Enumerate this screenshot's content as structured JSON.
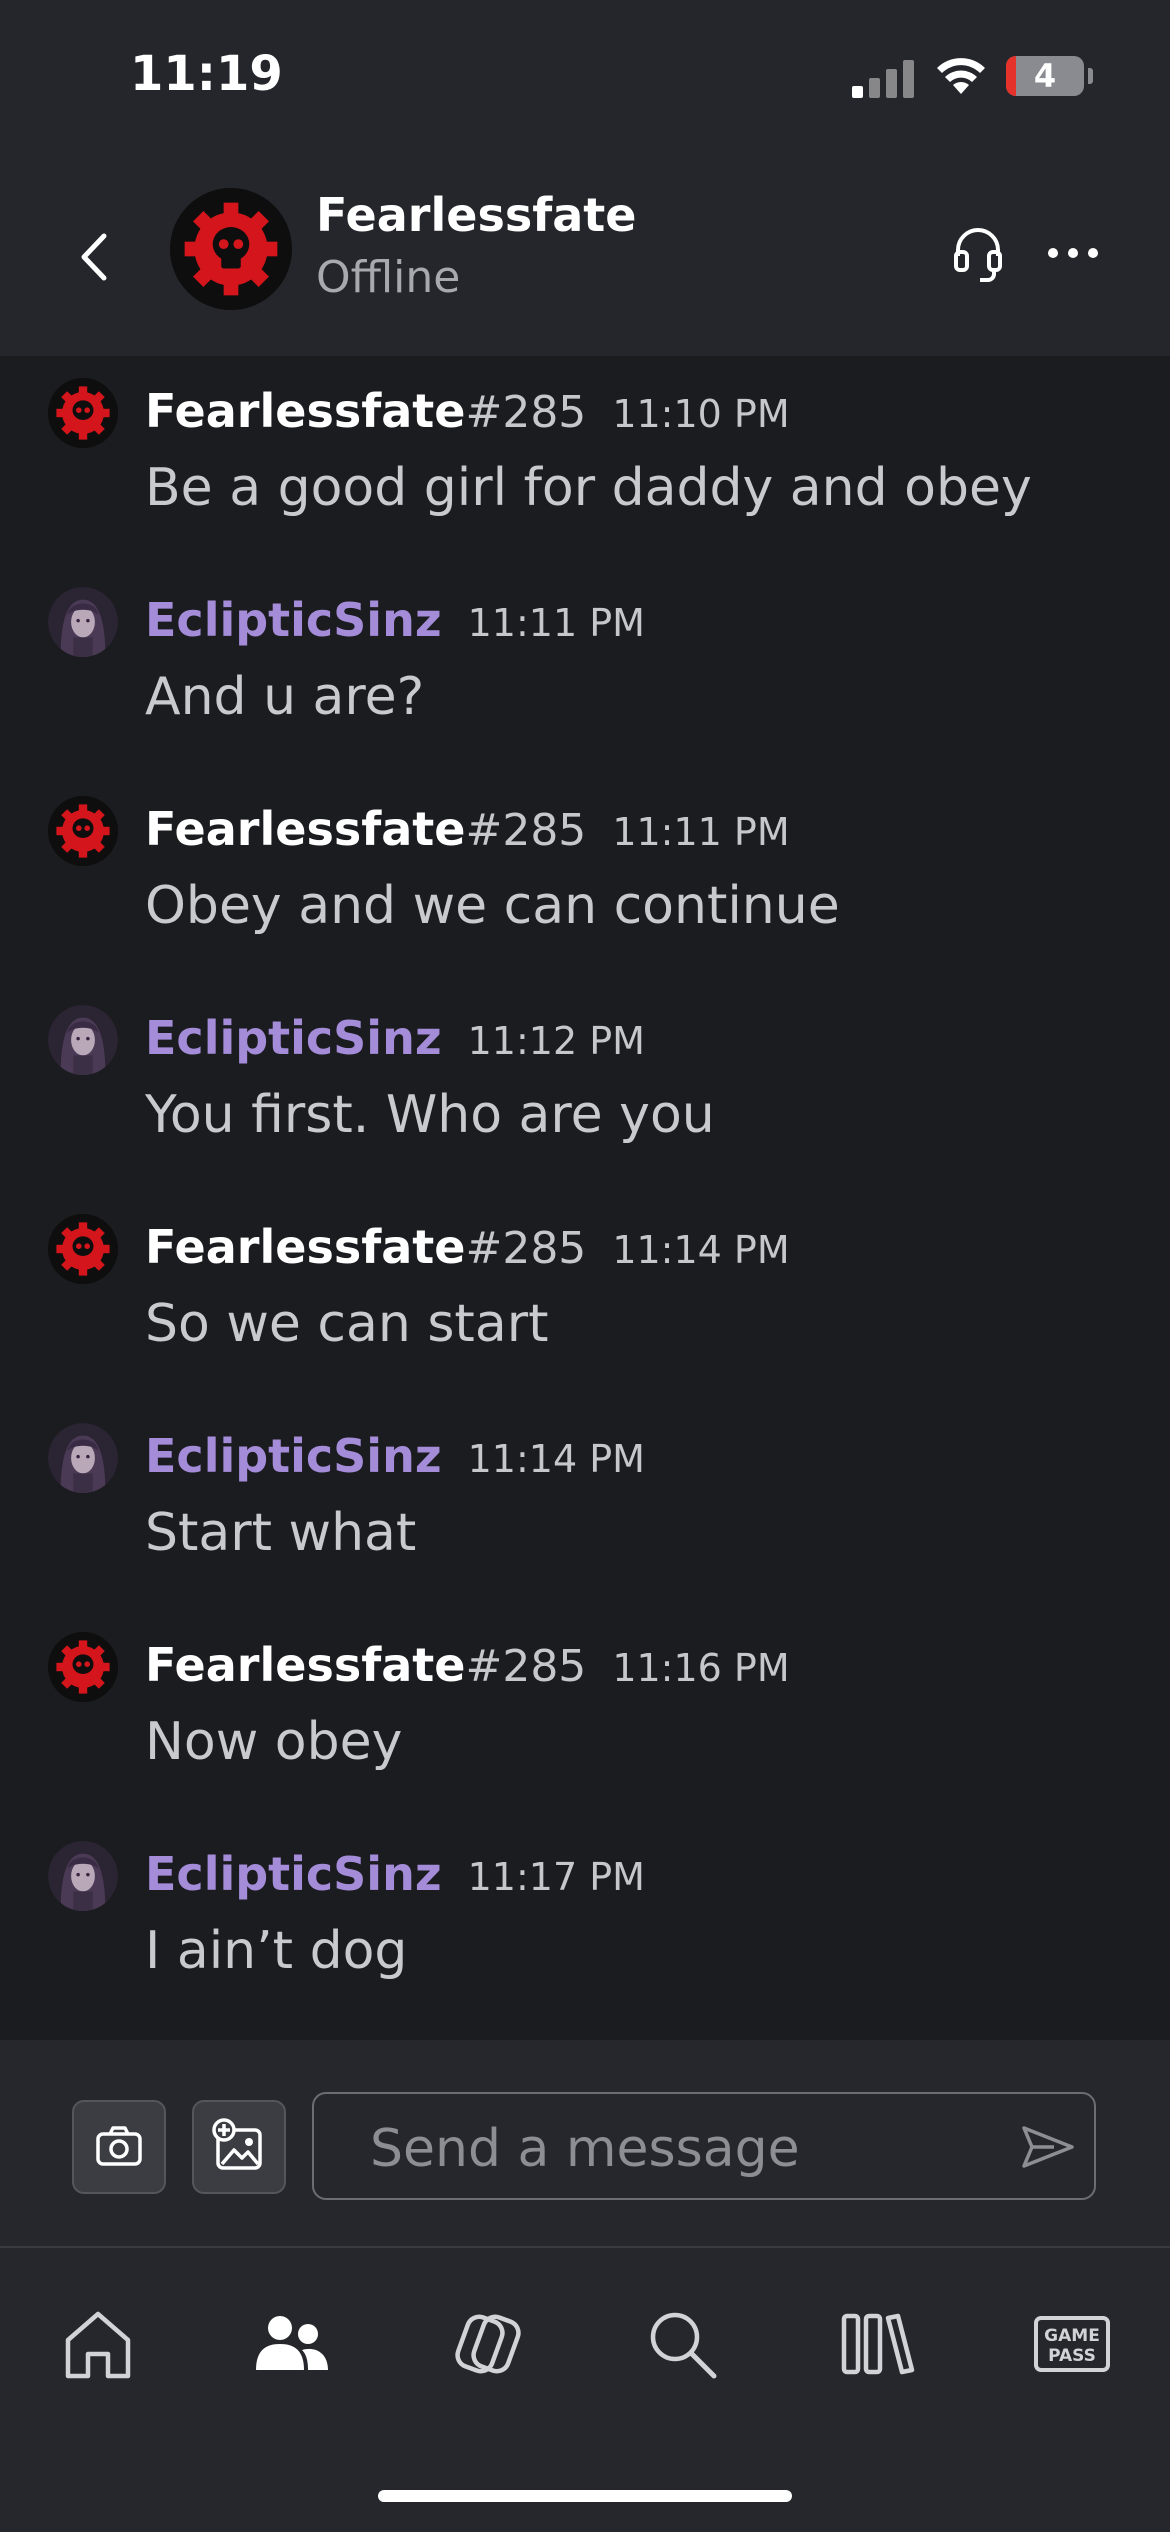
{
  "status_bar": {
    "time": "11:19",
    "battery": "4"
  },
  "header": {
    "name": "Fearlessfate",
    "status": "Offline"
  },
  "messages": [
    {
      "sender": "Fearlessfate",
      "tag": "#285",
      "time": "11:10 PM",
      "text": "Be a good girl for daddy and obey"
    },
    {
      "sender": "EclipticSinz",
      "tag": "",
      "time": "11:11 PM",
      "text": "And u are?"
    },
    {
      "sender": "Fearlessfate",
      "tag": "#285",
      "time": "11:11 PM",
      "text": "Obey and we can continue"
    },
    {
      "sender": "EclipticSinz",
      "tag": "",
      "time": "11:12 PM",
      "text": "You first. Who are you"
    },
    {
      "sender": "Fearlessfate",
      "tag": "#285",
      "time": "11:14 PM",
      "text": "So we can start"
    },
    {
      "sender": "EclipticSinz",
      "tag": "",
      "time": "11:14 PM",
      "text": "Start what"
    },
    {
      "sender": "Fearlessfate",
      "tag": "#285",
      "time": "11:16 PM",
      "text": "Now obey"
    },
    {
      "sender": "EclipticSinz",
      "tag": "",
      "time": "11:17 PM",
      "text": "I ain’t dog"
    }
  ],
  "composer": {
    "placeholder": "Send a message"
  },
  "tabbar": {
    "game_pass_line1": "GAME",
    "game_pass_line2": "PASS"
  },
  "colors": {
    "accent_purple": "#a48cd9",
    "gear_red": "#d4161c",
    "background": "#1b1c20"
  }
}
